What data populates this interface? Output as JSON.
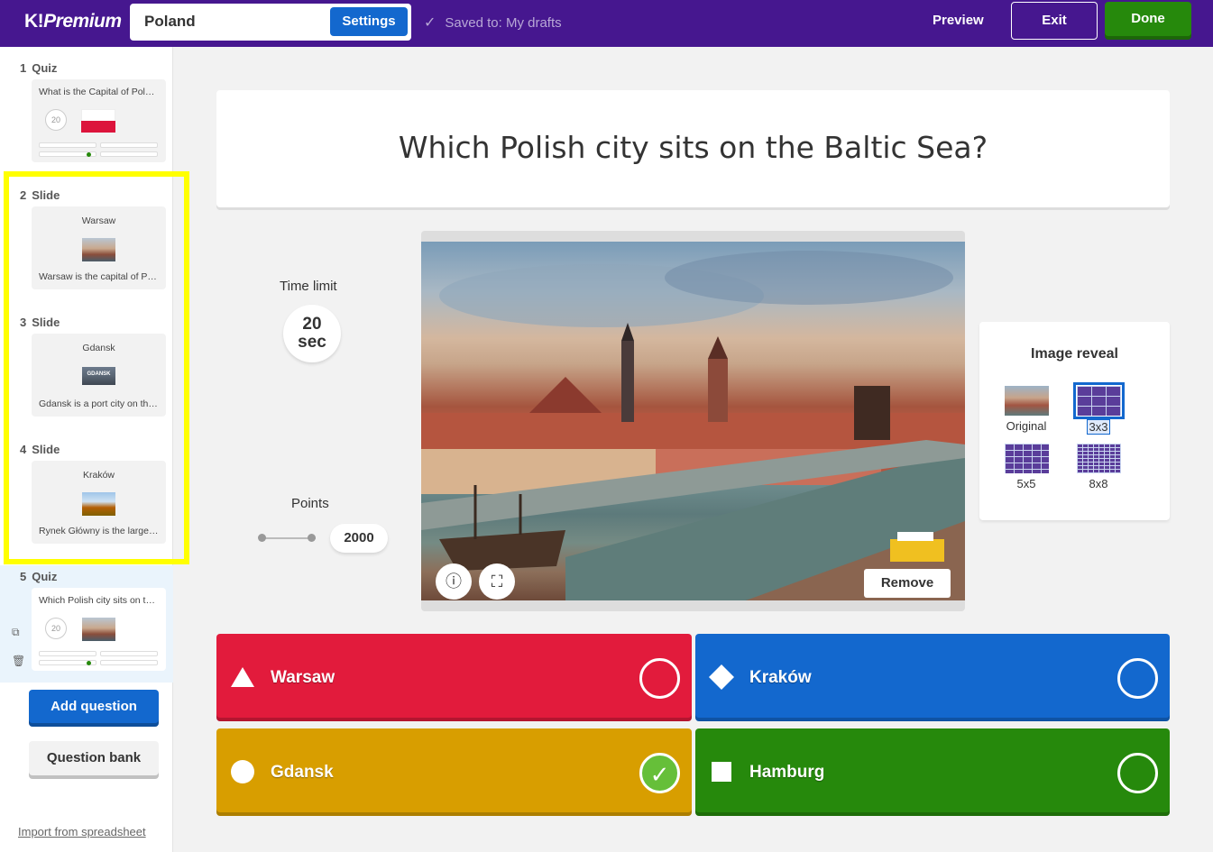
{
  "header": {
    "logo_mark": "K!",
    "logo_text": "Premium",
    "kahoot_title": "Poland",
    "settings_label": "Settings",
    "saved_status": "Saved to: My drafts",
    "preview_label": "Preview",
    "exit_label": "Exit",
    "done_label": "Done"
  },
  "sidebar": {
    "items": [
      {
        "number": "1",
        "type": "Quiz",
        "text": "What is the Capital of Poland?",
        "timer": "20"
      },
      {
        "number": "2",
        "type": "Slide",
        "title": "Warsaw",
        "body": "Warsaw is the capital of Poland"
      },
      {
        "number": "3",
        "type": "Slide",
        "title": "Gdansk",
        "body": "Gdansk is a port city on the Baltic",
        "thumb_label": "GDANSK"
      },
      {
        "number": "4",
        "type": "Slide",
        "title": "Kraków",
        "body": "Rynek Główny is the largest square"
      },
      {
        "number": "5",
        "type": "Quiz",
        "text": "Which Polish city sits on the Baltic Sea?",
        "timer": "20"
      }
    ],
    "add_question_label": "Add question",
    "question_bank_label": "Question bank",
    "import_label": "Import from spreadsheet"
  },
  "question": {
    "text": "Which Polish city sits on the Baltic Sea?"
  },
  "time_limit": {
    "label": "Time limit",
    "value": "20",
    "unit": "sec"
  },
  "points": {
    "label": "Points",
    "value": "2000"
  },
  "media": {
    "remove_label": "Remove"
  },
  "image_reveal": {
    "title": "Image reveal",
    "options": [
      {
        "label": "Original",
        "selected": false
      },
      {
        "label": "3x3",
        "selected": true
      },
      {
        "label": "5x5",
        "selected": false
      },
      {
        "label": "8x8",
        "selected": false
      }
    ]
  },
  "answers": [
    {
      "text": "Warsaw",
      "shape": "triangle",
      "color": "#e21b3c",
      "correct": false
    },
    {
      "text": "Kraków",
      "shape": "diamond",
      "color": "#1368ce",
      "correct": false
    },
    {
      "text": "Gdansk",
      "shape": "circle",
      "color": "#d89e00",
      "correct": true
    },
    {
      "text": "Hamburg",
      "shape": "square",
      "color": "#26890c",
      "correct": false
    }
  ],
  "colors": {
    "brand_purple": "#46178f",
    "highlight_yellow": "#ffff00"
  }
}
